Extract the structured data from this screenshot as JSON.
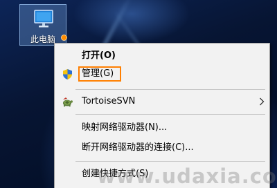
{
  "desktop": {
    "icon": {
      "label": "此电脑",
      "icon_name": "computer-monitor-icon"
    }
  },
  "context_menu": {
    "items": [
      {
        "label": "打开(O)",
        "bold": true
      },
      {
        "label": "管理(G)",
        "icon_name": "uac-shield-icon",
        "highlighted": true,
        "highlight_color": "#ff7f00"
      },
      {
        "label": "TortoiseSVN",
        "icon_name": "tortoise-svn-icon",
        "has_submenu": true
      },
      {
        "label": "映射网络驱动器(N)..."
      },
      {
        "label": "断开网络驱动器的连接(C)..."
      },
      {
        "label": "创建快捷方式(S)"
      }
    ]
  },
  "watermark": {
    "text": "www.udaxia.com"
  },
  "colors": {
    "menu_background": "#f2f2f2",
    "highlight_border": "#ff7f00",
    "desktop_background": "#0a1a3c"
  }
}
